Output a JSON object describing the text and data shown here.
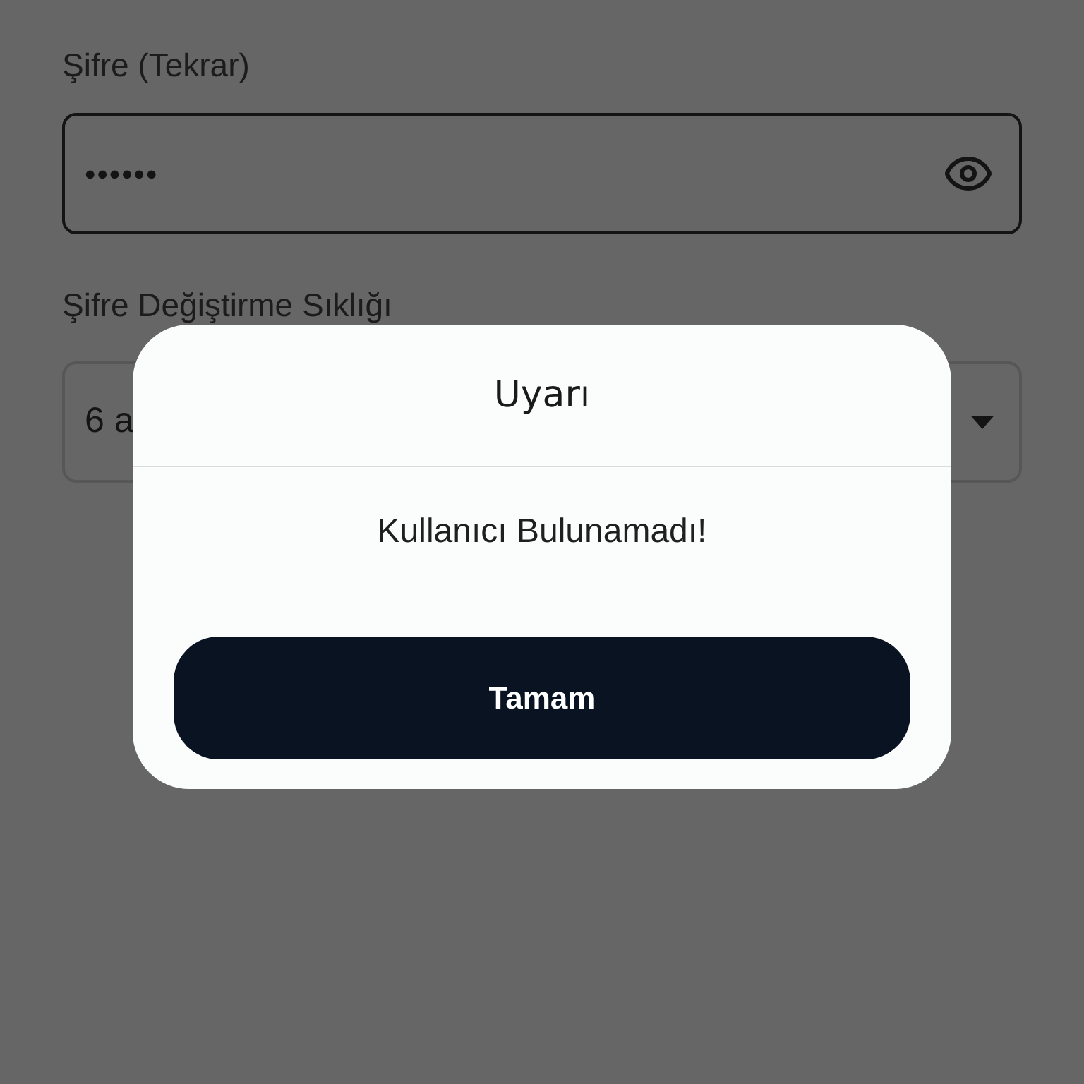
{
  "form": {
    "fields": [
      {
        "kind": "password",
        "label": "Şifre (Tekrar)",
        "value": "••••••",
        "focused": true
      },
      {
        "kind": "select",
        "label": "Şifre Değiştirme Sıklığı",
        "value": "6 a",
        "focused": false
      }
    ]
  },
  "dialog": {
    "title": "Uyarı",
    "message": "Kullanıcı Bulunamadı!",
    "buttons": [
      "Tamam"
    ]
  }
}
